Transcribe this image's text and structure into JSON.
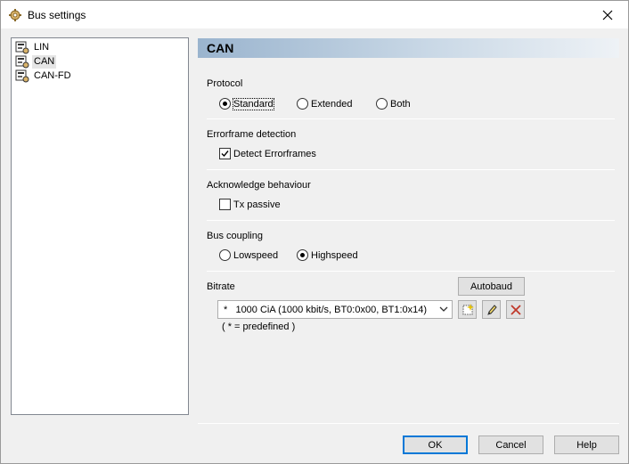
{
  "window": {
    "title": "Bus settings"
  },
  "tree": {
    "items": [
      {
        "label": "LIN"
      },
      {
        "label": "CAN",
        "selected": true
      },
      {
        "label": "CAN-FD"
      }
    ]
  },
  "panel": {
    "header": "CAN"
  },
  "protocol": {
    "label": "Protocol",
    "options": [
      {
        "label": "Standard",
        "selected": true
      },
      {
        "label": "Extended",
        "selected": false
      },
      {
        "label": "Both",
        "selected": false
      }
    ]
  },
  "errorframe": {
    "label": "Errorframe detection",
    "checkbox_label": "Detect Errorframes",
    "checked": true
  },
  "acknowledge": {
    "label": "Acknowledge behaviour",
    "checkbox_label": "Tx passive",
    "checked": false
  },
  "bus_coupling": {
    "label": "Bus coupling",
    "options": [
      {
        "label": "Lowspeed",
        "selected": false
      },
      {
        "label": "Highspeed",
        "selected": true
      }
    ]
  },
  "bitrate": {
    "label": "Bitrate",
    "autobaud_label": "Autobaud",
    "selected_value": "*   1000 CiA (1000 kbit/s, BT0:0x00, BT1:0x14)",
    "note": "( * = predefined )"
  },
  "footer": {
    "ok_label": "OK",
    "cancel_label": "Cancel",
    "help_label": "Help"
  },
  "icons": {
    "title": "settings-gear-icon",
    "tree_item": "bus-node-icon",
    "new": "new-entry-icon",
    "edit": "edit-icon",
    "delete": "delete-icon",
    "close": "close-icon"
  }
}
